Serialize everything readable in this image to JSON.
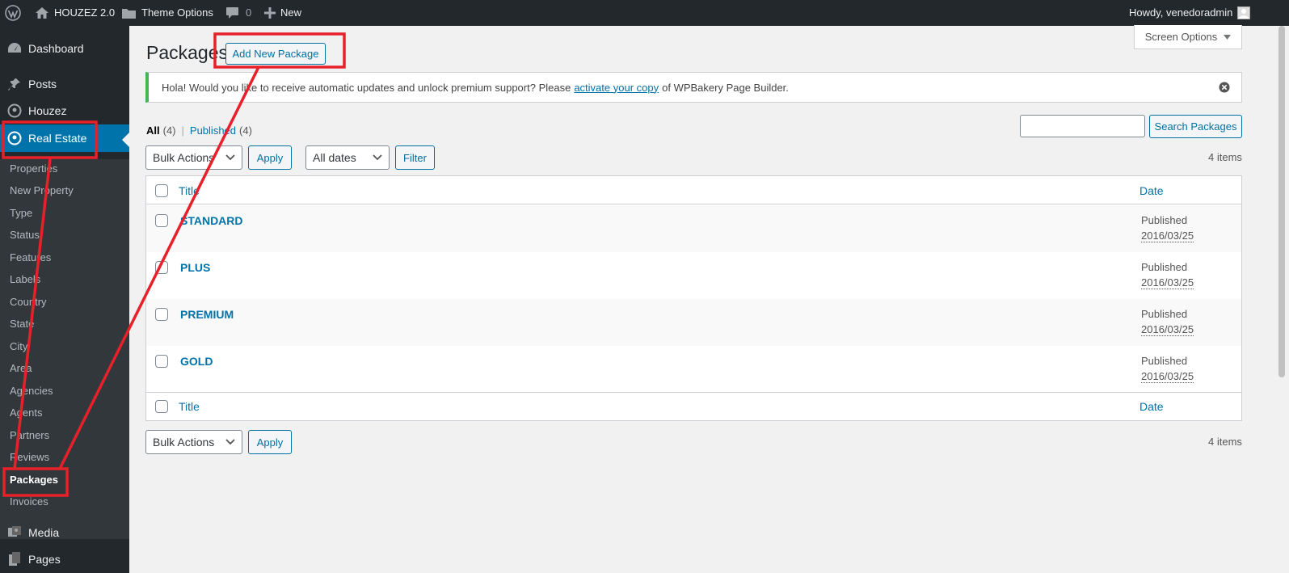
{
  "adminbar": {
    "site_name": "HOUZEZ 2.0",
    "theme_options": "Theme Options",
    "comments_count": "0",
    "new_label": "New",
    "howdy": "Howdy, venedoradmin"
  },
  "sidebar": {
    "top_items": [
      {
        "label": "Dashboard",
        "icon": "dashboard-icon"
      },
      {
        "label": "Posts",
        "icon": "pin-icon"
      },
      {
        "label": "Houzez",
        "icon": "location-icon"
      },
      {
        "label": "Real Estate",
        "icon": "location-icon"
      },
      {
        "label": "Media",
        "icon": "media-icon"
      },
      {
        "label": "Pages",
        "icon": "page-icon"
      }
    ],
    "sub_items": [
      "Properties",
      "New Property",
      "Type",
      "Status",
      "Features",
      "Labels",
      "Country",
      "State",
      "City",
      "Area",
      "Agencies",
      "Agents",
      "Partners",
      "Reviews",
      "Packages",
      "Invoices"
    ],
    "current_sub": "Packages"
  },
  "main": {
    "title": "Packages",
    "add_new": "Add New Package",
    "screen_options": "Screen Options",
    "notice": {
      "before": "Hola! Would you like to receive automatic updates and unlock premium support? Please",
      "link": "activate your copy",
      "after": "of WPBakery Page Builder."
    },
    "views": {
      "all": "All",
      "all_count": "(4)",
      "separator": "|",
      "published": "Published",
      "published_count": "(4)"
    },
    "search_button": "Search Packages",
    "search_value": "",
    "bulk_actions": "Bulk Actions",
    "apply": "Apply",
    "all_dates": "All dates",
    "filter": "Filter",
    "items_count": "4 items",
    "columns": {
      "title": "Title",
      "date": "Date"
    },
    "rows": [
      {
        "title": "STANDARD",
        "status": "Published",
        "date": "2016/03/25"
      },
      {
        "title": "PLUS",
        "status": "Published",
        "date": "2016/03/25"
      },
      {
        "title": "PREMIUM",
        "status": "Published",
        "date": "2016/03/25"
      },
      {
        "title": "GOLD",
        "status": "Published",
        "date": "2016/03/25"
      }
    ]
  },
  "colors": {
    "admin_bg": "#23282d",
    "active_blue": "#0073aa",
    "link_blue": "#0073aa",
    "notice_green": "#46b450",
    "annotation_red": "#e8202a"
  }
}
